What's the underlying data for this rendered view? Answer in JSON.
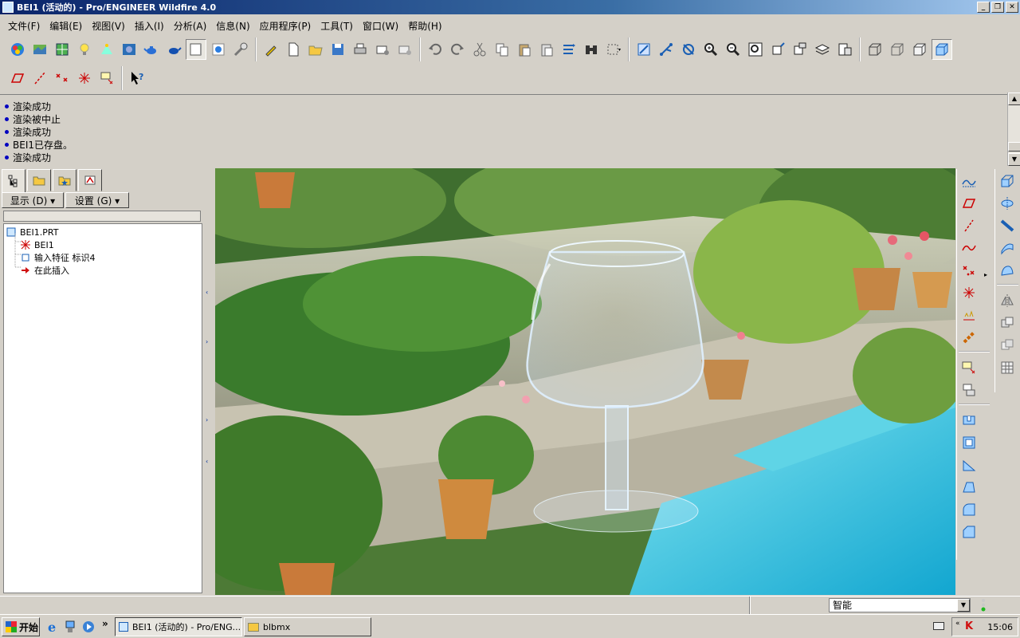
{
  "window": {
    "title": "BEI1 (活动的) - Pro/ENGINEER Wildfire 4.0",
    "buttons": [
      "_",
      "❐",
      "✕"
    ]
  },
  "menu": [
    "文件(F)",
    "编辑(E)",
    "视图(V)",
    "插入(I)",
    "分析(A)",
    "信息(N)",
    "应用程序(P)",
    "工具(T)",
    "窗口(W)",
    "帮助(H)"
  ],
  "messages": [
    "渲染成功",
    "渲染被中止",
    "渲染成功",
    "BEI1已存盘。",
    "渲染成功"
  ],
  "navigator": {
    "show_menu": "显示 (D) ▾",
    "settings_menu": "设置 (G) ▾",
    "tree": [
      {
        "label": "BEI1.PRT",
        "icon": "part-icon"
      },
      {
        "label": "BEI1",
        "icon": "csys-icon"
      },
      {
        "label": "输入特征 标识4",
        "icon": "import-feature-icon"
      },
      {
        "label": "在此插入",
        "icon": "insert-here-arrow-icon"
      }
    ]
  },
  "status": {
    "filter": "智能"
  },
  "taskbar": {
    "start": "开始",
    "tasks": [
      "BEI1 (活动的) - Pro/ENG...",
      "blbmx"
    ],
    "more": "»",
    "clock": "15:06"
  },
  "colors": {
    "titlebar": "#0a246a",
    "chrome": "#d4d0c8",
    "pool": "#3cc8e0",
    "foliage": "#3f7a2a"
  }
}
